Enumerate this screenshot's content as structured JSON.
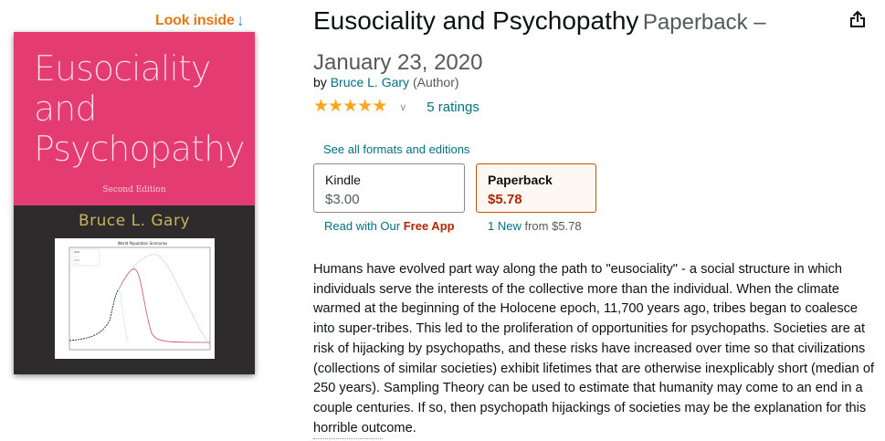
{
  "look_inside": {
    "label": "Look inside",
    "icon": "arrow-down-icon"
  },
  "cover": {
    "title": "Eusociality\nand\nPsychopathy",
    "edition": "Second Edition",
    "author": "Bruce L. Gary",
    "chart_title": "World Population Scenarios",
    "colors": {
      "top": "#e43c72",
      "bottom": "#2e2b2c",
      "author": "#cab05a"
    }
  },
  "book": {
    "title": "Eusociality and Psychopathy",
    "format_date": "Paperback – January 23, 2020",
    "by": "by",
    "author": "Bruce L. Gary",
    "author_role": "(Author)",
    "rating_stars": 5,
    "ratings_count": "5 ratings"
  },
  "formats": {
    "see_all": "See all formats and editions",
    "kindle": {
      "name": "Kindle",
      "price": "$3.00",
      "sub_prefix": "Read with Our",
      "sub_highlight": "Free App"
    },
    "paperback": {
      "name": "Paperback",
      "price": "$5.78",
      "new_count": "1 New",
      "from": "from $5.78"
    }
  },
  "description": "Humans have evolved part way along the path to \"eusociality\" - a social structure in which individuals serve the interests of the collective more than the individual. When the climate warmed at the beginning of the Holocene epoch, 11,700 years ago, tribes began to coalesce into super-tribes. This led to the proliferation of opportunities for psychopaths. Societies are at risk of hijacking by psychopaths, and these risks have increased over time so that civilizations (collections of similar societies) exhibit lifetimes that are otherwise inexplicably short (median of 250 years). Sampling Theory can be used to estimate that humanity may come to an end in a couple centuries. If so, then psychopath hijackings of societies may be the explanation for this horrible outcome.",
  "colors": {
    "link": "#007185",
    "price": "#b12704",
    "star": "#ffa41c",
    "look_inside": "#e47911"
  }
}
